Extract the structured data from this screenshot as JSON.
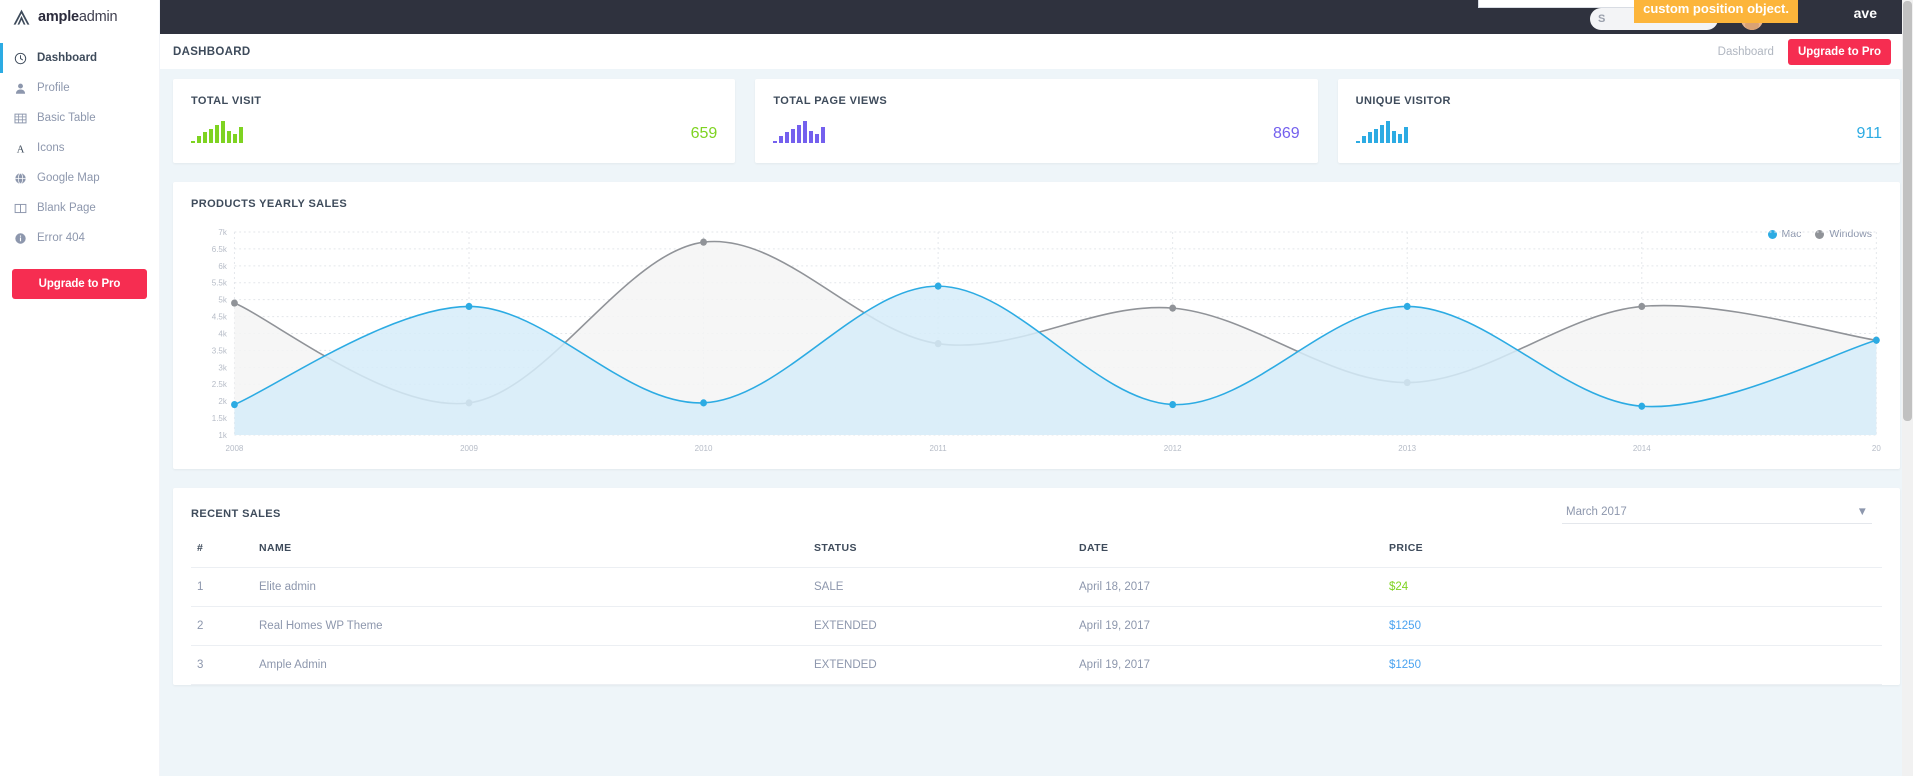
{
  "brand": {
    "bold": "ample",
    "light": "admin",
    "logo_icon": "mountain-logo-icon"
  },
  "sidebar": {
    "items": [
      {
        "label": "Dashboard",
        "icon": "clock-icon",
        "active": true
      },
      {
        "label": "Profile",
        "icon": "user-icon",
        "active": false
      },
      {
        "label": "Basic Table",
        "icon": "table-icon",
        "active": false
      },
      {
        "label": "Icons",
        "icon": "letter-a-icon",
        "active": false
      },
      {
        "label": "Google Map",
        "icon": "globe-icon",
        "active": false
      },
      {
        "label": "Blank Page",
        "icon": "columns-icon",
        "active": false
      },
      {
        "label": "Error 404",
        "icon": "info-icon",
        "active": false
      }
    ],
    "upgrade_label": "Upgrade to Pro"
  },
  "topbar": {
    "toast_text": "custom position object.",
    "save_label": "ave",
    "pill_text": "S",
    "avatar_icon": "user-avatar"
  },
  "header": {
    "title": "DASHBOARD",
    "breadcrumb": "Dashboard",
    "upgrade_label": "Upgrade to Pro"
  },
  "stats": [
    {
      "title": "TOTAL VISIT",
      "value": "659",
      "color": "#7ed321",
      "spark": [
        2,
        7,
        11,
        14,
        18,
        22,
        12,
        9,
        16
      ]
    },
    {
      "title": "TOTAL PAGE VIEWS",
      "value": "869",
      "color": "#7460ee",
      "spark": [
        2,
        7,
        11,
        14,
        18,
        22,
        12,
        9,
        16
      ]
    },
    {
      "title": "UNIQUE VISITOR",
      "value": "911",
      "color": "#2cabe3",
      "spark": [
        2,
        7,
        11,
        14,
        18,
        22,
        12,
        9,
        16
      ]
    }
  ],
  "chart_data": {
    "type": "line",
    "title": "PRODUCTS YEARLY SALES",
    "xlabel": "",
    "ylabel": "",
    "grid": true,
    "legend_position": "top-right",
    "x": [
      "2008",
      "2009",
      "2010",
      "2011",
      "2012",
      "2013",
      "2014",
      "20"
    ],
    "ylim": [
      1000,
      7000
    ],
    "yticks": [
      "1k",
      "1.5k",
      "2k",
      "2.5k",
      "3k",
      "3.5k",
      "4k",
      "4.5k",
      "5k",
      "5.5k",
      "6k",
      "6.5k",
      "7k"
    ],
    "series": [
      {
        "name": "Mac",
        "color": "#2cabe3",
        "fill": "#d6ecf9",
        "values": [
          1900,
          4800,
          1950,
          5400,
          1900,
          4800,
          1850,
          3800
        ]
      },
      {
        "name": "Windows",
        "color": "#909398",
        "fill": "#f5f5f5",
        "values": [
          4900,
          1950,
          6700,
          3700,
          4750,
          2550,
          4800,
          3800
        ]
      }
    ]
  },
  "recent_sales": {
    "title": "RECENT SALES",
    "month_filter": "March 2017",
    "caret_icon": "caret-down-icon",
    "columns": [
      "#",
      "NAME",
      "STATUS",
      "DATE",
      "PRICE"
    ],
    "rows": [
      {
        "num": "1",
        "name": "Elite admin",
        "status": "SALE",
        "date": "April 18, 2017",
        "price": "$24",
        "price_class": "price-green"
      },
      {
        "num": "2",
        "name": "Real Homes WP Theme",
        "status": "EXTENDED",
        "date": "April 19, 2017",
        "price": "$1250",
        "price_class": "price-blue"
      },
      {
        "num": "3",
        "name": "Ample Admin",
        "status": "EXTENDED",
        "date": "April 19, 2017",
        "price": "$1250",
        "price_class": "price-blue"
      }
    ]
  }
}
